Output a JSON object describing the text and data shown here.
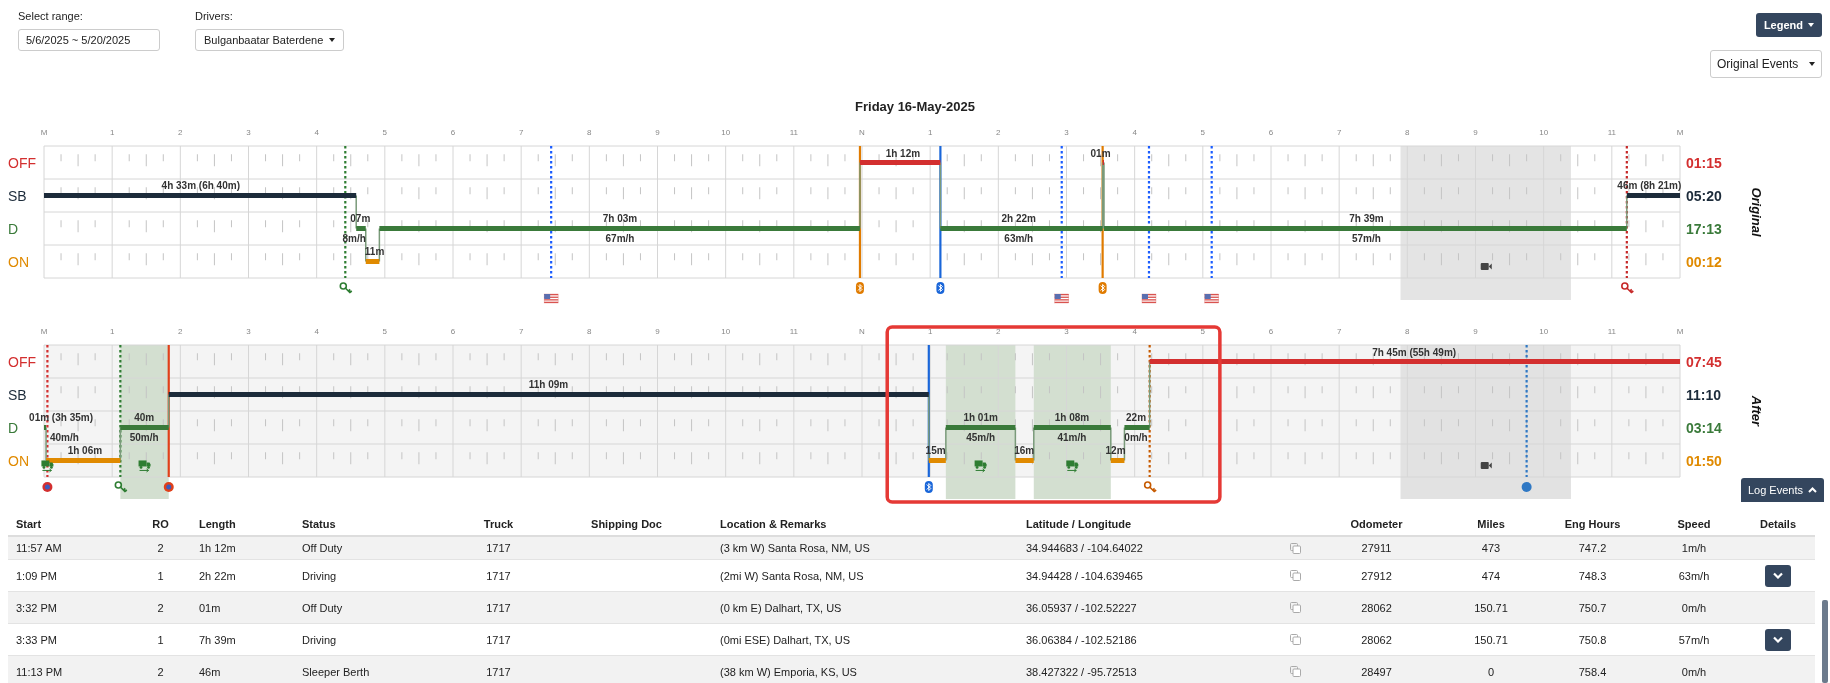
{
  "controls": {
    "range": {
      "label": "Select range:",
      "value": "5/6/2025 ~ 5/20/2025"
    },
    "drivers": {
      "label": "Drivers:",
      "value": "Bulganbaatar Baterdene"
    },
    "legend_button": "Legend",
    "events_dropdown": "Original Events"
  },
  "title": "Friday 16-May-2025",
  "logs": [
    {
      "side_label": "Original",
      "hour_labels": [
        "M",
        "1",
        "2",
        "3",
        "4",
        "5",
        "6",
        "7",
        "8",
        "9",
        "10",
        "11",
        "N",
        "1",
        "2",
        "3",
        "4",
        "5",
        "6",
        "7",
        "8",
        "9",
        "10",
        "11",
        "M"
      ],
      "rows": [
        {
          "label": "OFF",
          "color": "#d32f2f"
        },
        {
          "label": "SB",
          "color": "#1c2b3a"
        },
        {
          "label": "D",
          "color": "#3a7a3a"
        },
        {
          "label": "ON",
          "color": "#e08a00"
        }
      ],
      "totals": [
        {
          "text": "01:15",
          "color": "#d32f2f"
        },
        {
          "text": "05:20",
          "color": "#1c2b3a"
        },
        {
          "text": "17:13",
          "color": "#3a7a3a"
        },
        {
          "text": "00:12",
          "color": "#e08a00"
        }
      ],
      "duration_labels": [
        "4h 33m (6h 40m)",
        "07m",
        "8m/h",
        "11m",
        "7h 03m",
        "67m/h",
        "1h 12m",
        "2h 22m",
        "63m/h",
        "01m",
        "7h 39m",
        "57m/h",
        "46m (8h 21m)"
      ]
    },
    {
      "side_label": "After",
      "hour_labels": [
        "M",
        "1",
        "2",
        "3",
        "4",
        "5",
        "6",
        "7",
        "8",
        "9",
        "10",
        "11",
        "N",
        "1",
        "2",
        "3",
        "4",
        "5",
        "6",
        "7",
        "8",
        "9",
        "10",
        "11",
        "M"
      ],
      "rows": [
        {
          "label": "OFF",
          "color": "#d32f2f"
        },
        {
          "label": "SB",
          "color": "#1c2b3a"
        },
        {
          "label": "D",
          "color": "#3a7a3a"
        },
        {
          "label": "ON",
          "color": "#e08a00"
        }
      ],
      "totals": [
        {
          "text": "07:45",
          "color": "#d32f2f"
        },
        {
          "text": "11:10",
          "color": "#1c2b3a"
        },
        {
          "text": "03:14",
          "color": "#3a7a3a"
        },
        {
          "text": "01:50",
          "color": "#e08a00"
        }
      ],
      "duration_labels": [
        "01m (3h 35m)",
        "40m/h",
        "1h 06m",
        "40m",
        "50m/h",
        "11h 09m",
        "15m",
        "1h 01m",
        "45m/h",
        "16m",
        "1h 08m",
        "41m/h",
        "12m",
        "22m",
        "0m/h",
        "7h 45m (55h 49m)"
      ]
    }
  ],
  "log_events_button": "Log Events",
  "table": {
    "columns": [
      "Start",
      "RO",
      "Length",
      "Status",
      "Truck",
      "Shipping Doc",
      "Location & Remarks",
      "Latitude / Longitude",
      "Odometer",
      "Miles",
      "Eng Hours",
      "Speed",
      "Details"
    ],
    "rows": [
      {
        "start": "11:57 AM",
        "ro": "2",
        "length": "1h 12m",
        "status": "Off Duty",
        "truck": "1717",
        "location": "(3 km W) Santa Rosa, NM, US",
        "lat_long": "34.944683 / -104.64022",
        "odometer": "27911",
        "miles": "473",
        "eng_hours": "747.2",
        "speed": "1m/h",
        "details": false
      },
      {
        "start": "1:09 PM",
        "ro": "1",
        "length": "2h 22m",
        "status": "Driving",
        "truck": "1717",
        "location": "(2mi W) Santa Rosa, NM, US",
        "lat_long": "34.94428 / -104.639465",
        "odometer": "27912",
        "miles": "474",
        "eng_hours": "748.3",
        "speed": "63m/h",
        "details": true
      },
      {
        "start": "3:32 PM",
        "ro": "2",
        "length": "01m",
        "status": "Off Duty",
        "truck": "1717",
        "location": "(0 km E) Dalhart, TX, US",
        "lat_long": "36.05937 / -102.52227",
        "odometer": "28062",
        "miles": "150.71",
        "eng_hours": "750.7",
        "speed": "0m/h",
        "details": false
      },
      {
        "start": "3:33 PM",
        "ro": "1",
        "length": "7h 39m",
        "status": "Driving",
        "truck": "1717",
        "location": "(0mi ESE) Dalhart, TX, US",
        "lat_long": "36.06384 / -102.52186",
        "odometer": "28062",
        "miles": "150.71",
        "eng_hours": "750.8",
        "speed": "57m/h",
        "details": true
      },
      {
        "start": "11:13 PM",
        "ro": "2",
        "length": "46m",
        "status": "Sleeper Berth",
        "truck": "1717",
        "location": "(38 km W) Emporia, KS, US",
        "lat_long": "38.427322 / -95.72513",
        "odometer": "28497",
        "miles": "0",
        "eng_hours": "758.4",
        "speed": "0m/h",
        "details": false
      }
    ]
  }
}
